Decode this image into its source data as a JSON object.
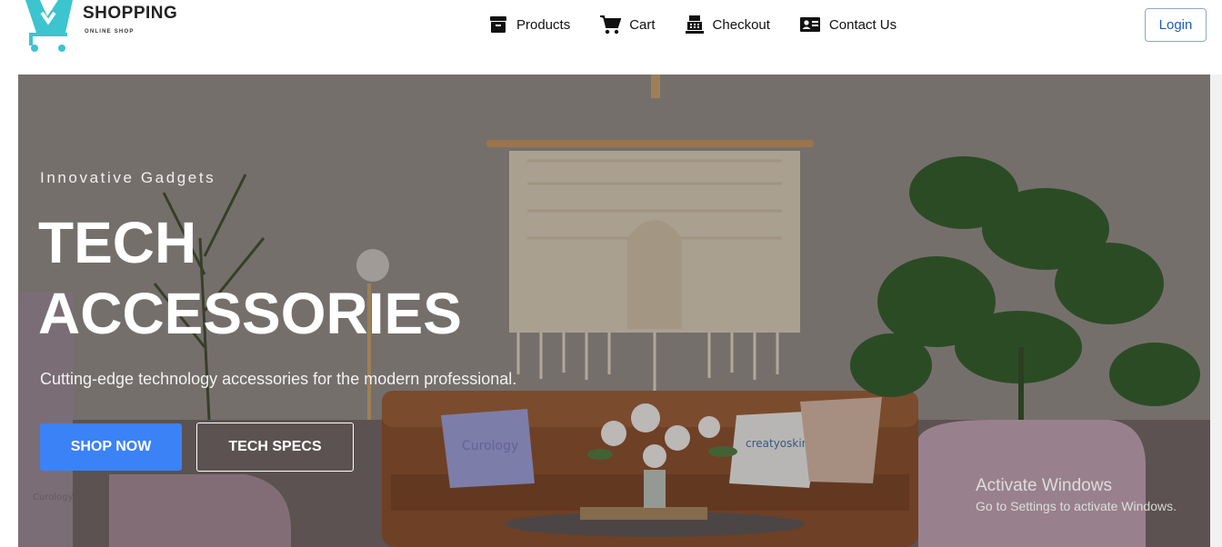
{
  "brand": {
    "name": "SHOPPING",
    "tagline": "ONLINE SHOP",
    "color": "#3cc4cf"
  },
  "nav": [
    {
      "label": "Products",
      "icon": "archive-box-icon"
    },
    {
      "label": "Cart",
      "icon": "cart-icon"
    },
    {
      "label": "Checkout",
      "icon": "cash-register-icon"
    },
    {
      "label": "Contact Us",
      "icon": "contact-card-icon"
    }
  ],
  "login_label": "Login",
  "hero": {
    "eyebrow": "Innovative Gadgets",
    "title_line1": "TECH",
    "title_line2": "ACCESSORIES",
    "subtitle": "Cutting-edge technology accessories for the modern professional.",
    "primary_cta": "SHOP NOW",
    "secondary_cta": "TECH SPECS",
    "pillow_left": "Curology",
    "pillow_right": "creatyoskin",
    "pillow_chair": "Curology"
  },
  "watermark": {
    "title": "Activate Windows",
    "subtitle": "Go to Settings to activate Windows."
  },
  "colors": {
    "accent": "#3b82f6",
    "login_text": "#1a5fb4"
  }
}
